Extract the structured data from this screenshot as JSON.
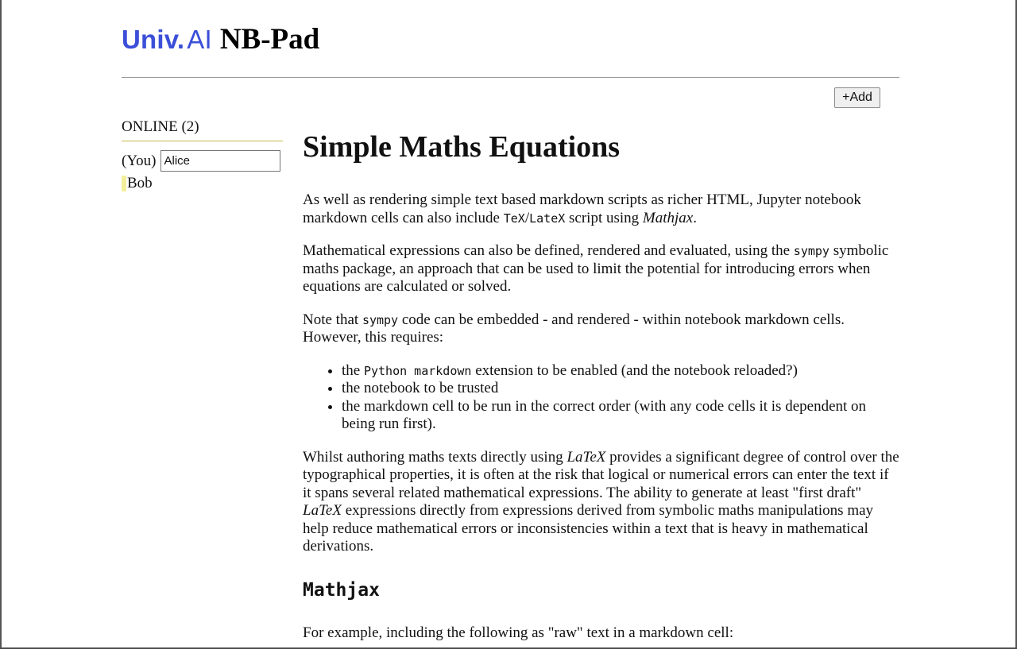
{
  "header": {
    "logo_univ": "Univ.",
    "logo_ai": "AI",
    "app_title": "NB-Pad"
  },
  "toolbar": {
    "add_label": "+Add"
  },
  "sidebar": {
    "online_title": "ONLINE (2)",
    "you_label": "(You)",
    "you_name_value": "Alice",
    "users": [
      {
        "name": "Bob",
        "marker_color": "#f3ef9a"
      }
    ]
  },
  "doc": {
    "title": "Simple Maths Equations",
    "p1": {
      "a": "As well as rendering simple text based markdown scripts as richer HTML, Jupyter notebook markdown cells can also include ",
      "code1": "TeX",
      "sep": "/",
      "code2": "LateX",
      "b": " script using ",
      "em": "Mathjax",
      "c": "."
    },
    "p2": {
      "a": "Mathematical expressions can also be defined, rendered and evaluated, using the ",
      "code": "sympy",
      "b": " symbolic maths package, an approach that can be used to limit the potential for introducing errors when equations are calculated or solved."
    },
    "p3": {
      "a": "Note that ",
      "code": "sympy",
      "b": " code can be embedded - and rendered - within notebook markdown cells. However, this requires:"
    },
    "list": {
      "item1_a": "the ",
      "item1_code": "Python markdown",
      "item1_b": " extension to be enabled (and the notebook reloaded?)",
      "item2": "the notebook to be trusted",
      "item3": "the markdown cell to be run in the correct order (with any code cells it is dependent on being run first)."
    },
    "p4": {
      "a": "Whilst authoring maths texts directly using ",
      "em1": "LaTeX",
      "b": " provides a significant degree of control over the typographical properties, it is often at the risk that logical or numerical errors can enter the text if it spans several related mathematical expressions. The ability to generate at least \"first draft\" ",
      "em2": "LaTeX",
      "c": " expressions directly from expressions derived from symbolic maths manipulations may help reduce mathematical errors or inconsistencies within a text that is heavy in mathematical derivations."
    },
    "h3": "Mathjax",
    "p5": "For example, including the following as \"raw\" text in a markdown cell:"
  },
  "colors": {
    "brand": "#3b4fd8",
    "online_rule": "#c8b84a",
    "user_marker": "#f3ef9a"
  }
}
